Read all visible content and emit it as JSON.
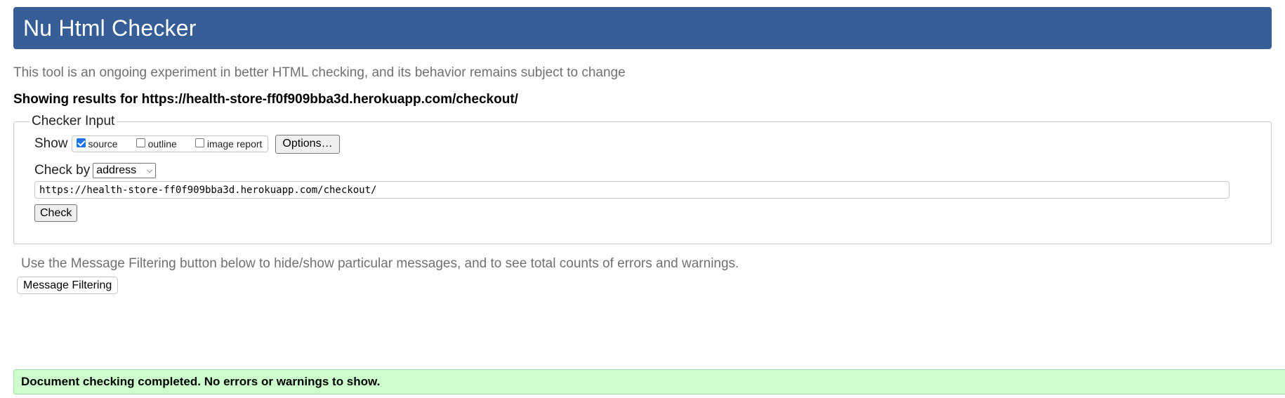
{
  "header": {
    "title": "Nu Html Checker"
  },
  "intro": "This tool is an ongoing experiment in better HTML checking, and its behavior remains subject to change",
  "showing_results": "Showing results for https://health-store-ff0f909bba3d.herokuapp.com/checkout/",
  "checker_input": {
    "legend": "Checker Input",
    "show_label": "Show",
    "show_options": [
      {
        "label": "source",
        "checked": true
      },
      {
        "label": "outline",
        "checked": false
      },
      {
        "label": "image report",
        "checked": false
      }
    ],
    "options_button": "Options…",
    "check_by_label": "Check by",
    "check_by_selected": "address",
    "url_value": "https://health-store-ff0f909bba3d.herokuapp.com/checkout/",
    "check_button": "Check"
  },
  "filter": {
    "hint": "Use the Message Filtering button below to hide/show particular messages, and to see total counts of errors and warnings.",
    "button": "Message Filtering"
  },
  "result": {
    "message": "Document checking completed. No errors or warnings to show.",
    "color": "#ccffcc"
  },
  "colors": {
    "header_bg": "#365d95",
    "checkbox_checked": "#1a73e8"
  }
}
